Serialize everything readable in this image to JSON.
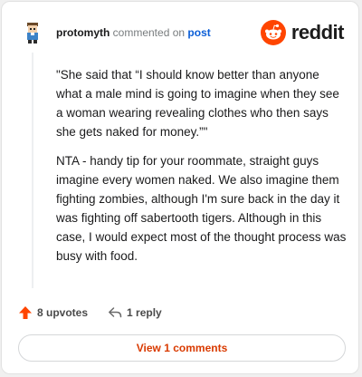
{
  "comment": {
    "author": "protomyth",
    "action": "commented on",
    "post_link": "post",
    "paragraphs": [
      "\"She said that “I should know better than anyone what a male mind is going to imagine when they see a woman wearing revealing clothes who then says she gets naked for money.”\"",
      "NTA - handy tip for your roommate, straight guys imagine every women naked. We also imagine them fighting zombies, although I'm sure back in the day it was fighting off sabertooth tigers. Although in this case, I would expect most of the thought process was busy with food."
    ],
    "upvotes": "8 upvotes",
    "replies": "1 reply"
  },
  "brand": {
    "name": "reddit",
    "color": "#ff4500"
  },
  "view_comments_label": "View 1 comments",
  "colors": {
    "upvote_arrow": "#ff4500",
    "view_button_text": "#d93a00",
    "link": "#0b5ed7"
  }
}
